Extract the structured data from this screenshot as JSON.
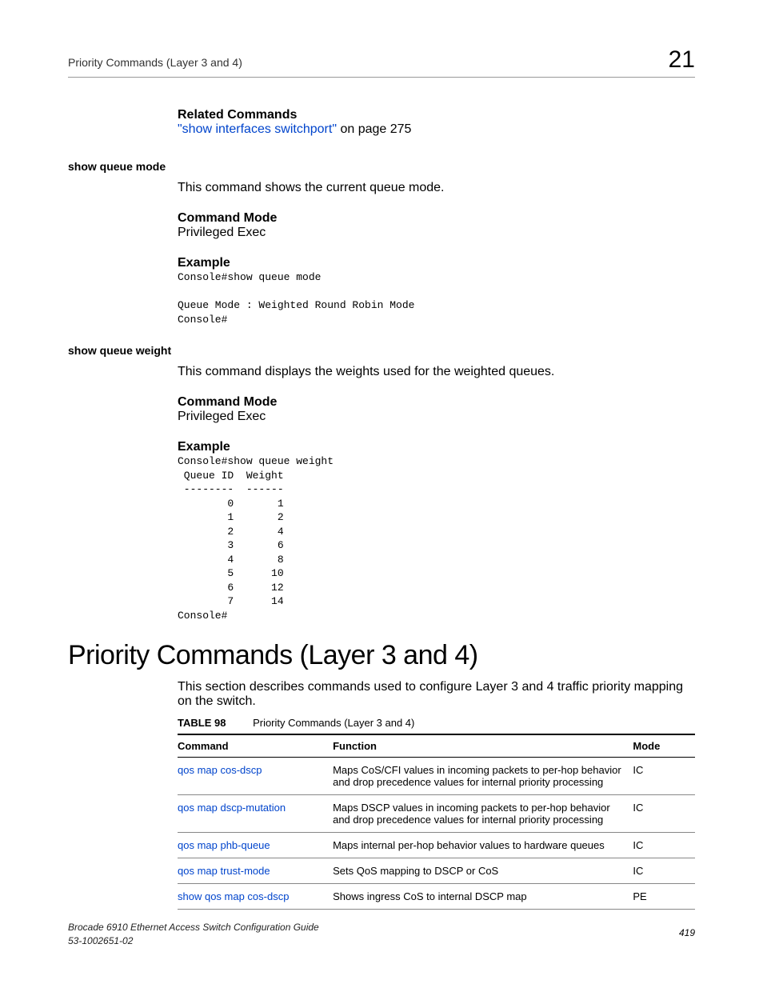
{
  "header": {
    "title": "Priority Commands (Layer 3 and 4)",
    "chapter": "21"
  },
  "s_related": {
    "heading": "Related Commands",
    "link_text": "\"show interfaces switchport\"",
    "link_tail": " on page 275"
  },
  "s_mode": {
    "side": "show queue mode",
    "intro": "This command shows the current queue mode.",
    "cmode_h": "Command Mode",
    "cmode_v": "Privileged Exec",
    "ex_h": "Example",
    "ex_code": "Console#show queue mode\n\nQueue Mode : Weighted Round Robin Mode\nConsole#"
  },
  "s_weight": {
    "side": "show queue weight",
    "intro": "This command displays the weights used for the weighted queues.",
    "cmode_h": "Command Mode",
    "cmode_v": "Privileged Exec",
    "ex_h": "Example",
    "ex_code": "Console#show queue weight\n Queue ID  Weight\n --------  ------\n        0       1\n        1       2\n        2       4\n        3       6\n        4       8\n        5      10\n        6      12\n        7      14\nConsole#"
  },
  "section": {
    "title": "Priority Commands (Layer 3 and 4)",
    "intro": "This section describes commands used to configure Layer 3 and 4 traffic priority mapping on the switch.",
    "table_label": "TABLE 98",
    "table_caption": "Priority Commands (Layer 3 and 4)",
    "th": {
      "c": "Command",
      "f": "Function",
      "m": "Mode"
    },
    "rows": [
      {
        "c": "qos map cos-dscp",
        "f": "Maps CoS/CFI values in incoming packets to per-hop behavior and drop precedence values for internal priority processing",
        "m": "IC"
      },
      {
        "c": "qos map dscp-mutation",
        "f": "Maps DSCP values in incoming packets to per-hop behavior and drop precedence values for internal priority processing",
        "m": "IC"
      },
      {
        "c": "qos map phb-queue",
        "f": "Maps internal per-hop behavior values to hardware queues",
        "m": "IC"
      },
      {
        "c": "qos map trust-mode",
        "f": "Sets QoS mapping to DSCP or CoS",
        "m": "IC"
      },
      {
        "c": "show qos map cos-dscp",
        "f": "Shows ingress CoS to internal DSCP map",
        "m": "PE"
      }
    ]
  },
  "footer": {
    "l1": "Brocade 6910 Ethernet Access Switch Configuration Guide",
    "l2": "53-1002651-02",
    "page": "419"
  }
}
